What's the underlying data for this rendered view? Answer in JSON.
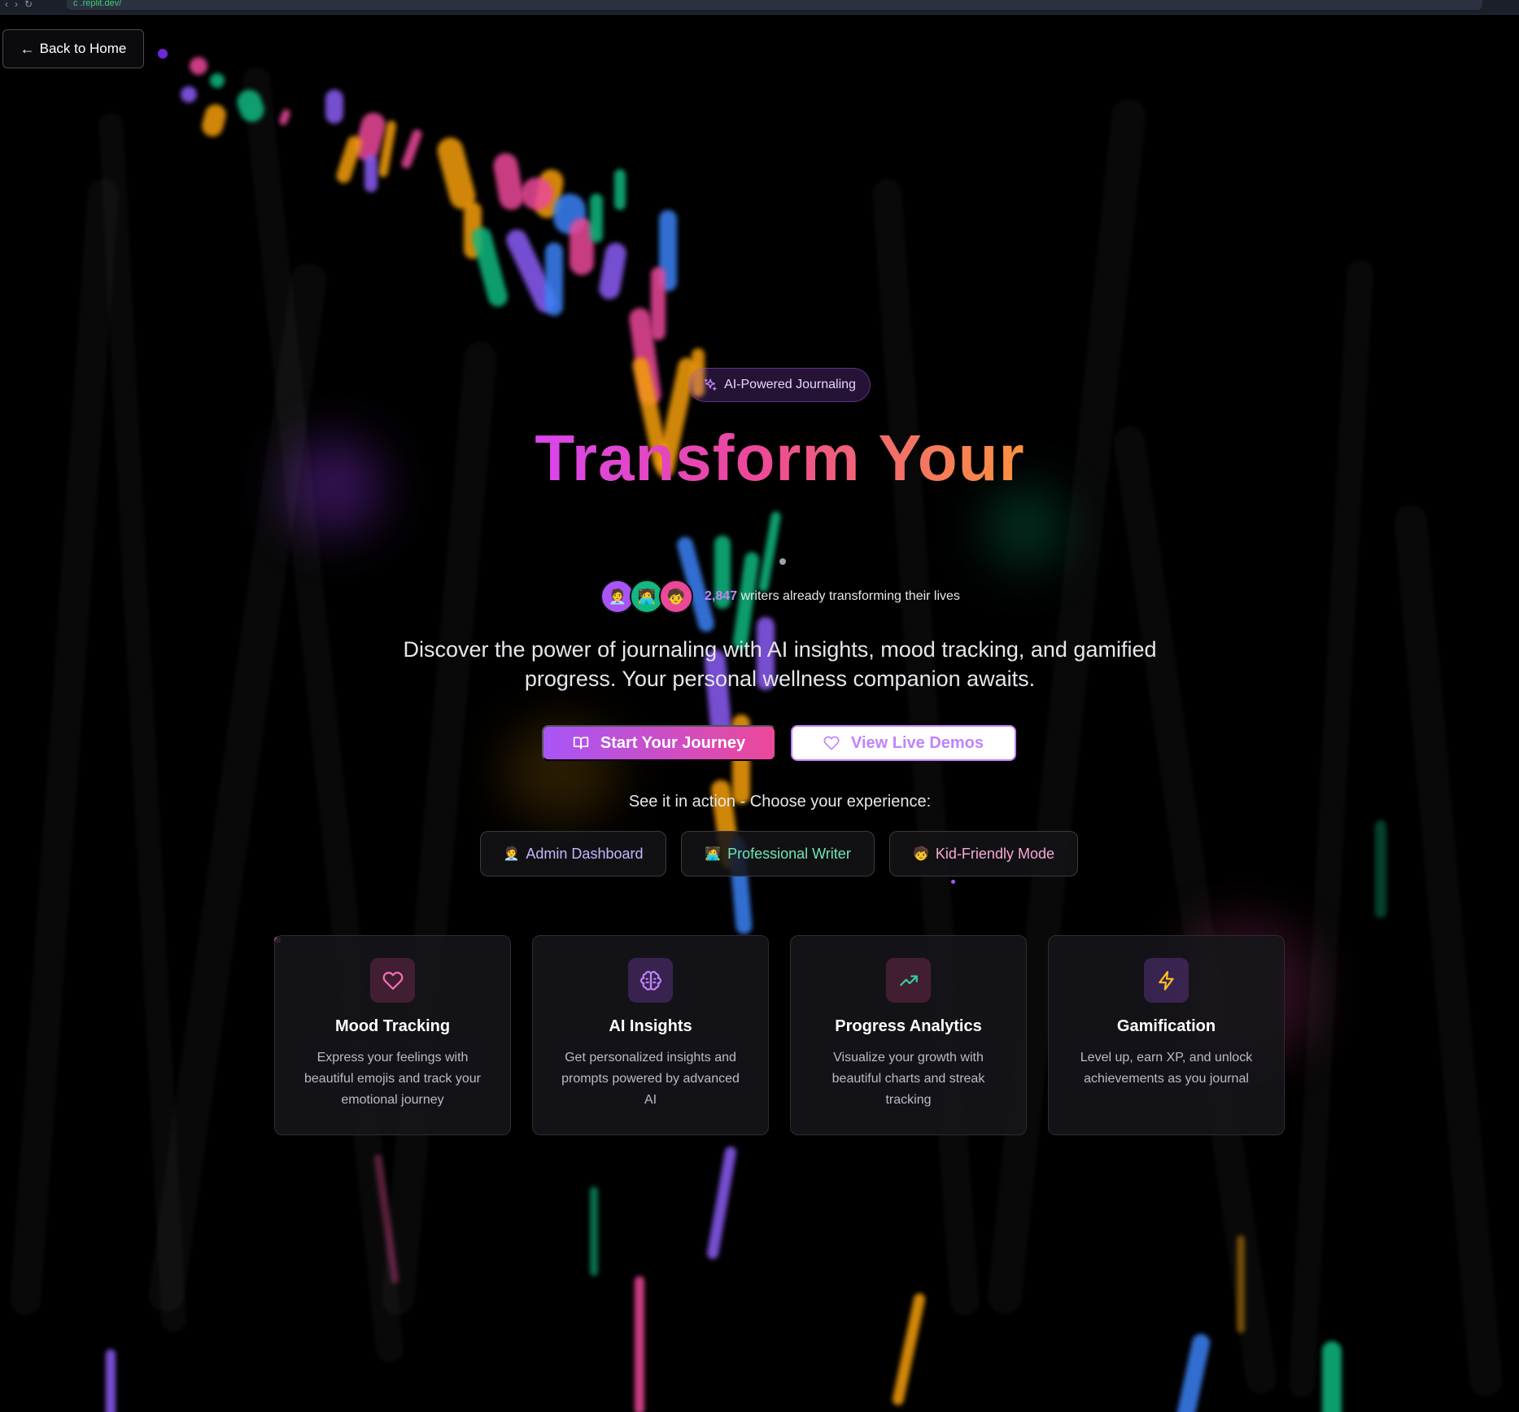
{
  "browser": {
    "nav_icons": [
      "back-icon",
      "forward-icon",
      "reload-icon"
    ],
    "url": "c .replit.dev/"
  },
  "back_button": {
    "label": "Back to Home",
    "icon": "arrow-left-icon"
  },
  "hero": {
    "badge": {
      "label": "AI-Powered Journaling",
      "icon": "sparkles-icon"
    },
    "title": "Transform Your",
    "social_proof": {
      "avatars": [
        "🧑‍💼",
        "🧑‍💻",
        "🧒"
      ],
      "count": "2,847",
      "text": "writers already transforming their lives"
    },
    "subtitle": "Discover the power of journaling with AI insights, mood tracking, and gamified progress. Your personal wellness companion awaits."
  },
  "cta": {
    "primary": {
      "label": "Start Your Journey",
      "icon": "book-open-icon"
    },
    "secondary": {
      "label": "View Live Demos",
      "icon": "heart-icon"
    }
  },
  "demo": {
    "heading": "See it in action - Choose your experience:",
    "options": [
      {
        "label": "Admin Dashboard",
        "emoji": "🧑‍💼"
      },
      {
        "label": "Professional Writer",
        "emoji": "🧑‍💻"
      },
      {
        "label": "Kid-Friendly Mode",
        "emoji": "🧒"
      }
    ]
  },
  "features": [
    {
      "title": "Mood Tracking",
      "description": "Express your feelings with beautiful emojis and track your emotional journey",
      "icon": "heart-icon",
      "color": "#f472b6"
    },
    {
      "title": "AI Insights",
      "description": "Get personalized insights and prompts powered by advanced AI",
      "icon": "brain-icon",
      "color": "#c084fc"
    },
    {
      "title": "Progress Analytics",
      "description": "Visualize your growth with beautiful charts and streak tracking",
      "icon": "trending-up-icon",
      "color": "#34d399"
    },
    {
      "title": "Gamification",
      "description": "Level up, earn XP, and unlock achievements as you journal",
      "icon": "zap-icon",
      "color": "#fbbf24"
    }
  ],
  "colors": {
    "accent_purple": "#a855f7",
    "accent_pink": "#ec4899",
    "accent_orange": "#fb923c",
    "background": "#000000"
  }
}
